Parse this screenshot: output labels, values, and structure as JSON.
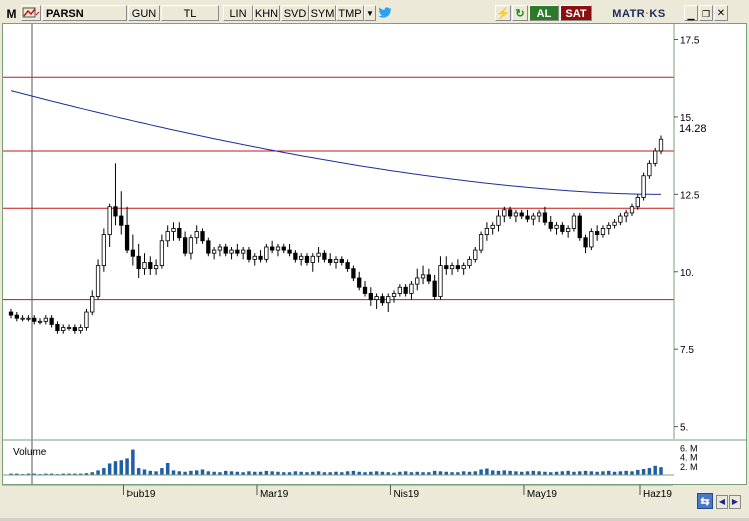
{
  "toolbar": {
    "symbol_label": "M",
    "symbol": "PARSN",
    "period": "GUN",
    "currency": "TL",
    "lin": "LIN",
    "khn": "KHN",
    "svd": "SVD",
    "sym": "SYM",
    "tmp": "TMP",
    "al": "AL",
    "sat": "SAT",
    "brand_left": "MATR",
    "brand_right": "KS"
  },
  "icons": [
    "m-icon",
    "multi-icon",
    "dropdown-icon",
    "twitter-icon",
    "lightning-icon",
    "refresh-icon",
    "minimize-icon",
    "restore-icon",
    "close-icon",
    "nav-refresh-icon",
    "nav-left-icon",
    "nav-right-icon"
  ],
  "chart_data": {
    "type": "candlestick",
    "symbol": "PARSN",
    "y_ticks": [
      "17.5",
      "15.",
      "12.5",
      "10.",
      "7.5",
      "5."
    ],
    "price_label": "14.28",
    "x_ticks": [
      "Þub19",
      "Mar19",
      "Nis19",
      "May19",
      "Haz19"
    ],
    "horizontal_lines": [
      16.28,
      13.9,
      12.05,
      9.1
    ],
    "volume_title": "Volume",
    "volume_ticks": [
      "6. M",
      "4. M",
      "2. M"
    ],
    "colors": {
      "up_body": "#ffffff",
      "down_body": "#000000",
      "hline": "#c01818",
      "ma": "#1d2e9a",
      "volume": "#1f5fa6",
      "grid_frame": "#7aa07a"
    },
    "ylim": [
      4.6,
      18.0
    ],
    "ohlc": [
      [
        8.7,
        8.8,
        8.5,
        8.6
      ],
      [
        8.6,
        8.7,
        8.4,
        8.5
      ],
      [
        8.5,
        8.6,
        8.4,
        8.5
      ],
      [
        8.5,
        8.6,
        8.4,
        8.5
      ],
      [
        8.5,
        8.6,
        8.3,
        8.4
      ],
      [
        8.4,
        8.5,
        8.3,
        8.4
      ],
      [
        8.4,
        8.6,
        8.3,
        8.5
      ],
      [
        8.5,
        8.6,
        8.2,
        8.3
      ],
      [
        8.3,
        8.4,
        8.0,
        8.1
      ],
      [
        8.1,
        8.3,
        8.0,
        8.2
      ],
      [
        8.2,
        8.3,
        8.1,
        8.2
      ],
      [
        8.2,
        8.3,
        8.0,
        8.1
      ],
      [
        8.1,
        8.3,
        8.0,
        8.2
      ],
      [
        8.2,
        8.8,
        8.1,
        8.7
      ],
      [
        8.7,
        9.4,
        8.6,
        9.2
      ],
      [
        9.2,
        10.4,
        9.1,
        10.2
      ],
      [
        10.2,
        11.4,
        10.0,
        11.2
      ],
      [
        11.2,
        12.2,
        10.8,
        12.1
      ],
      [
        12.1,
        13.5,
        11.5,
        11.8
      ],
      [
        11.8,
        12.6,
        11.2,
        11.5
      ],
      [
        11.5,
        12.1,
        10.6,
        10.7
      ],
      [
        10.7,
        11.2,
        10.2,
        10.5
      ],
      [
        10.5,
        10.9,
        9.8,
        10.1
      ],
      [
        10.1,
        10.6,
        9.9,
        10.3
      ],
      [
        10.3,
        10.5,
        9.9,
        10.1
      ],
      [
        10.1,
        10.4,
        9.9,
        10.2
      ],
      [
        10.2,
        11.2,
        10.1,
        11.0
      ],
      [
        11.0,
        11.5,
        10.8,
        11.3
      ],
      [
        11.3,
        11.6,
        11.0,
        11.4
      ],
      [
        11.4,
        11.6,
        11.0,
        11.1
      ],
      [
        11.1,
        11.3,
        10.5,
        10.6
      ],
      [
        10.6,
        11.2,
        10.4,
        11.1
      ],
      [
        11.1,
        11.5,
        10.9,
        11.3
      ],
      [
        11.3,
        11.4,
        10.9,
        11.0
      ],
      [
        11.0,
        11.1,
        10.5,
        10.6
      ],
      [
        10.6,
        10.8,
        10.4,
        10.7
      ],
      [
        10.7,
        10.9,
        10.5,
        10.8
      ],
      [
        10.8,
        10.9,
        10.5,
        10.6
      ],
      [
        10.6,
        10.8,
        10.4,
        10.7
      ],
      [
        10.7,
        10.9,
        10.5,
        10.6
      ],
      [
        10.6,
        10.8,
        10.4,
        10.7
      ],
      [
        10.7,
        10.8,
        10.3,
        10.4
      ],
      [
        10.4,
        10.6,
        10.2,
        10.5
      ],
      [
        10.5,
        10.7,
        10.3,
        10.4
      ],
      [
        10.4,
        10.9,
        10.3,
        10.8
      ],
      [
        10.8,
        11.0,
        10.6,
        10.7
      ],
      [
        10.7,
        10.9,
        10.5,
        10.8
      ],
      [
        10.8,
        10.9,
        10.6,
        10.7
      ],
      [
        10.7,
        10.9,
        10.5,
        10.6
      ],
      [
        10.6,
        10.7,
        10.3,
        10.4
      ],
      [
        10.4,
        10.6,
        10.2,
        10.5
      ],
      [
        10.5,
        10.6,
        10.2,
        10.3
      ],
      [
        10.3,
        10.6,
        10.0,
        10.5
      ],
      [
        10.5,
        10.8,
        10.3,
        10.6
      ],
      [
        10.6,
        10.7,
        10.3,
        10.4
      ],
      [
        10.4,
        10.6,
        10.2,
        10.3
      ],
      [
        10.3,
        10.5,
        10.1,
        10.4
      ],
      [
        10.4,
        10.5,
        10.2,
        10.3
      ],
      [
        10.3,
        10.4,
        10.0,
        10.1
      ],
      [
        10.1,
        10.2,
        9.7,
        9.8
      ],
      [
        9.8,
        10.0,
        9.4,
        9.5
      ],
      [
        9.5,
        9.7,
        9.2,
        9.3
      ],
      [
        9.3,
        9.5,
        8.9,
        9.1
      ],
      [
        9.1,
        9.3,
        8.8,
        9.2
      ],
      [
        9.2,
        9.3,
        8.9,
        9.0
      ],
      [
        9.0,
        9.3,
        8.7,
        9.2
      ],
      [
        9.2,
        9.4,
        9.0,
        9.3
      ],
      [
        9.3,
        9.6,
        9.2,
        9.5
      ],
      [
        9.5,
        9.6,
        9.2,
        9.3
      ],
      [
        9.3,
        9.7,
        9.1,
        9.6
      ],
      [
        9.6,
        10.1,
        9.4,
        9.8
      ],
      [
        9.8,
        10.2,
        9.6,
        9.9
      ],
      [
        9.9,
        10.1,
        9.6,
        9.7
      ],
      [
        9.7,
        9.9,
        9.1,
        9.2
      ],
      [
        9.2,
        10.5,
        9.1,
        10.2
      ],
      [
        10.2,
        10.5,
        9.9,
        10.1
      ],
      [
        10.1,
        10.3,
        9.9,
        10.2
      ],
      [
        10.2,
        10.4,
        10.0,
        10.1
      ],
      [
        10.1,
        10.3,
        9.9,
        10.2
      ],
      [
        10.2,
        10.5,
        10.1,
        10.4
      ],
      [
        10.4,
        10.8,
        10.3,
        10.7
      ],
      [
        10.7,
        11.3,
        10.6,
        11.2
      ],
      [
        11.2,
        11.6,
        11.0,
        11.4
      ],
      [
        11.4,
        11.6,
        11.2,
        11.5
      ],
      [
        11.5,
        12.0,
        11.3,
        11.8
      ],
      [
        11.8,
        12.1,
        11.6,
        12.0
      ],
      [
        12.0,
        12.1,
        11.7,
        11.8
      ],
      [
        11.8,
        12.0,
        11.6,
        11.9
      ],
      [
        11.9,
        12.0,
        11.7,
        11.8
      ],
      [
        11.8,
        12.0,
        11.6,
        11.7
      ],
      [
        11.7,
        11.9,
        11.5,
        11.8
      ],
      [
        11.8,
        12.0,
        11.6,
        11.9
      ],
      [
        11.9,
        12.1,
        11.5,
        11.6
      ],
      [
        11.6,
        11.8,
        11.3,
        11.4
      ],
      [
        11.4,
        11.6,
        11.2,
        11.5
      ],
      [
        11.5,
        11.6,
        11.2,
        11.3
      ],
      [
        11.3,
        11.5,
        11.1,
        11.4
      ],
      [
        11.4,
        11.9,
        11.3,
        11.8
      ],
      [
        11.8,
        11.9,
        11.0,
        11.1
      ],
      [
        11.1,
        11.2,
        10.6,
        10.8
      ],
      [
        10.8,
        11.4,
        10.7,
        11.3
      ],
      [
        11.3,
        11.5,
        11.0,
        11.2
      ],
      [
        11.2,
        11.5,
        11.1,
        11.4
      ],
      [
        11.4,
        11.6,
        11.2,
        11.5
      ],
      [
        11.5,
        11.7,
        11.4,
        11.6
      ],
      [
        11.6,
        11.9,
        11.5,
        11.8
      ],
      [
        11.8,
        12.0,
        11.6,
        11.9
      ],
      [
        11.9,
        12.2,
        11.8,
        12.1
      ],
      [
        12.1,
        12.5,
        12.0,
        12.4
      ],
      [
        12.4,
        13.2,
        12.3,
        13.1
      ],
      [
        13.1,
        13.6,
        13.0,
        13.5
      ],
      [
        13.5,
        14.0,
        13.4,
        13.9
      ],
      [
        13.9,
        14.4,
        13.8,
        14.28
      ]
    ],
    "volume_m": [
      0.3,
      0.3,
      0.2,
      0.3,
      0.3,
      0.2,
      0.3,
      0.3,
      0.2,
      0.3,
      0.3,
      0.3,
      0.3,
      0.4,
      0.6,
      1.0,
      1.5,
      2.5,
      3.0,
      3.2,
      3.6,
      5.5,
      1.5,
      1.2,
      0.9,
      0.8,
      1.5,
      2.6,
      1.0,
      0.8,
      0.7,
      0.9,
      1.0,
      1.2,
      0.8,
      0.7,
      0.6,
      0.9,
      0.8,
      0.7,
      0.6,
      0.8,
      0.7,
      0.7,
      0.9,
      0.8,
      0.7,
      0.6,
      0.6,
      0.8,
      0.7,
      0.6,
      0.7,
      0.8,
      0.6,
      0.6,
      0.7,
      0.6,
      0.8,
      0.9,
      0.7,
      0.6,
      0.7,
      0.8,
      0.7,
      0.6,
      0.5,
      0.7,
      0.8,
      0.6,
      0.7,
      0.6,
      0.6,
      0.9,
      0.8,
      0.7,
      0.6,
      0.6,
      0.8,
      0.7,
      0.8,
      1.2,
      1.4,
      1.0,
      0.9,
      1.0,
      0.9,
      0.8,
      0.7,
      0.8,
      0.9,
      0.8,
      0.7,
      0.6,
      0.7,
      0.8,
      0.9,
      0.7,
      0.8,
      0.9,
      0.8,
      0.7,
      0.8,
      0.9,
      0.7,
      0.8,
      0.9,
      0.8,
      1.1,
      1.3,
      1.5,
      2.0,
      1.7
    ]
  }
}
